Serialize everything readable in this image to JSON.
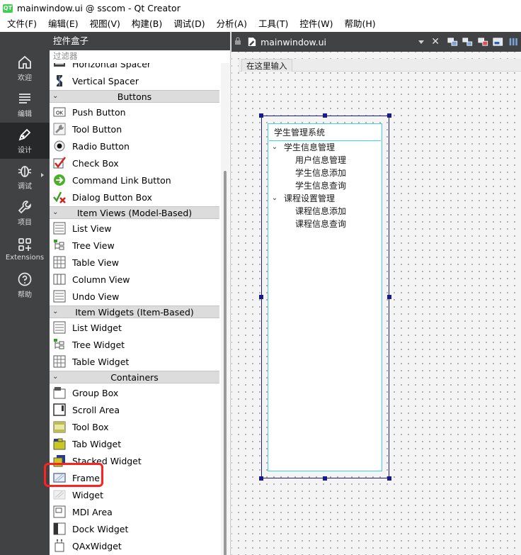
{
  "window": {
    "title": "mainwindow.ui @ sscom - Qt Creator",
    "logo": "QT"
  },
  "menubar": [
    "文件(F)",
    "编辑(E)",
    "视图(V)",
    "构建(B)",
    "调试(D)",
    "分析(A)",
    "工具(T)",
    "控件(W)",
    "帮助(H)"
  ],
  "modes": [
    {
      "label": "欢迎",
      "icon": "home-icon"
    },
    {
      "label": "编辑",
      "icon": "edit-icon"
    },
    {
      "label": "设计",
      "icon": "design-pen-icon",
      "active": true
    },
    {
      "label": "调试",
      "icon": "debug-bug-icon"
    },
    {
      "label": "项目",
      "icon": "wrench-icon"
    },
    {
      "label": "Extensions",
      "icon": "extensions-icon"
    },
    {
      "label": "帮助",
      "icon": "help-icon"
    }
  ],
  "widget_box": {
    "title": "控件盒子",
    "filter_placeholder": "过滤器",
    "items": [
      {
        "kind": "item",
        "label": "Horizontal Spacer",
        "icon": "horizontal-spacer-icon"
      },
      {
        "kind": "item",
        "label": "Vertical Spacer",
        "icon": "vertical-spacer-icon"
      },
      {
        "kind": "category",
        "label": "Buttons"
      },
      {
        "kind": "item",
        "label": "Push Button",
        "icon": "push-button-icon"
      },
      {
        "kind": "item",
        "label": "Tool Button",
        "icon": "tool-button-icon"
      },
      {
        "kind": "item",
        "label": "Radio Button",
        "icon": "radio-button-icon"
      },
      {
        "kind": "item",
        "label": "Check Box",
        "icon": "check-box-icon"
      },
      {
        "kind": "item",
        "label": "Command Link Button",
        "icon": "command-link-icon"
      },
      {
        "kind": "item",
        "label": "Dialog Button Box",
        "icon": "dialog-button-box-icon"
      },
      {
        "kind": "category",
        "label": "Item Views (Model-Based)"
      },
      {
        "kind": "item",
        "label": "List View",
        "icon": "list-view-icon"
      },
      {
        "kind": "item",
        "label": "Tree View",
        "icon": "tree-view-icon"
      },
      {
        "kind": "item",
        "label": "Table View",
        "icon": "table-view-icon"
      },
      {
        "kind": "item",
        "label": "Column View",
        "icon": "column-view-icon"
      },
      {
        "kind": "item",
        "label": "Undo View",
        "icon": "undo-view-icon"
      },
      {
        "kind": "category",
        "label": "Item Widgets (Item-Based)"
      },
      {
        "kind": "item",
        "label": "List Widget",
        "icon": "list-widget-icon"
      },
      {
        "kind": "item",
        "label": "Tree Widget",
        "icon": "tree-widget-icon"
      },
      {
        "kind": "item",
        "label": "Table Widget",
        "icon": "table-widget-icon"
      },
      {
        "kind": "category",
        "label": "Containers"
      },
      {
        "kind": "item",
        "label": "Group Box",
        "icon": "group-box-icon"
      },
      {
        "kind": "item",
        "label": "Scroll Area",
        "icon": "scroll-area-icon"
      },
      {
        "kind": "item",
        "label": "Tool Box",
        "icon": "tool-box-icon"
      },
      {
        "kind": "item",
        "label": "Tab Widget",
        "icon": "tab-widget-icon"
      },
      {
        "kind": "item",
        "label": "Stacked Widget",
        "icon": "stacked-widget-icon"
      },
      {
        "kind": "item",
        "label": "Frame",
        "icon": "frame-icon",
        "highlighted": true
      },
      {
        "kind": "item",
        "label": "Widget",
        "icon": "widget-icon"
      },
      {
        "kind": "item",
        "label": "MDI Area",
        "icon": "mdi-area-icon"
      },
      {
        "kind": "item",
        "label": "Dock Widget",
        "icon": "dock-widget-icon"
      },
      {
        "kind": "item",
        "label": "QAxWidget",
        "icon": "qaxwidget-icon"
      }
    ]
  },
  "editor": {
    "file_name": "mainwindow.ui",
    "menu_placeholder": "在这里输入",
    "tree": {
      "header": "学生管理系统",
      "nodes": [
        {
          "label": "学生信息管理",
          "level": 0,
          "expanded": true
        },
        {
          "label": "用户信息管理",
          "level": 1
        },
        {
          "label": "学生信息添加",
          "level": 1
        },
        {
          "label": "学生信息查询",
          "level": 1
        },
        {
          "label": "课程设置管理",
          "level": 0,
          "expanded": true
        },
        {
          "label": "课程信息添加",
          "level": 1
        },
        {
          "label": "课程信息查询",
          "level": 1
        }
      ]
    }
  },
  "colors": {
    "mode_bar": "#404244",
    "mode_active": "#262829",
    "highlight_box": "#ff2020",
    "selection": "#1a1a8a",
    "tree_border": "#3fd3e0"
  }
}
